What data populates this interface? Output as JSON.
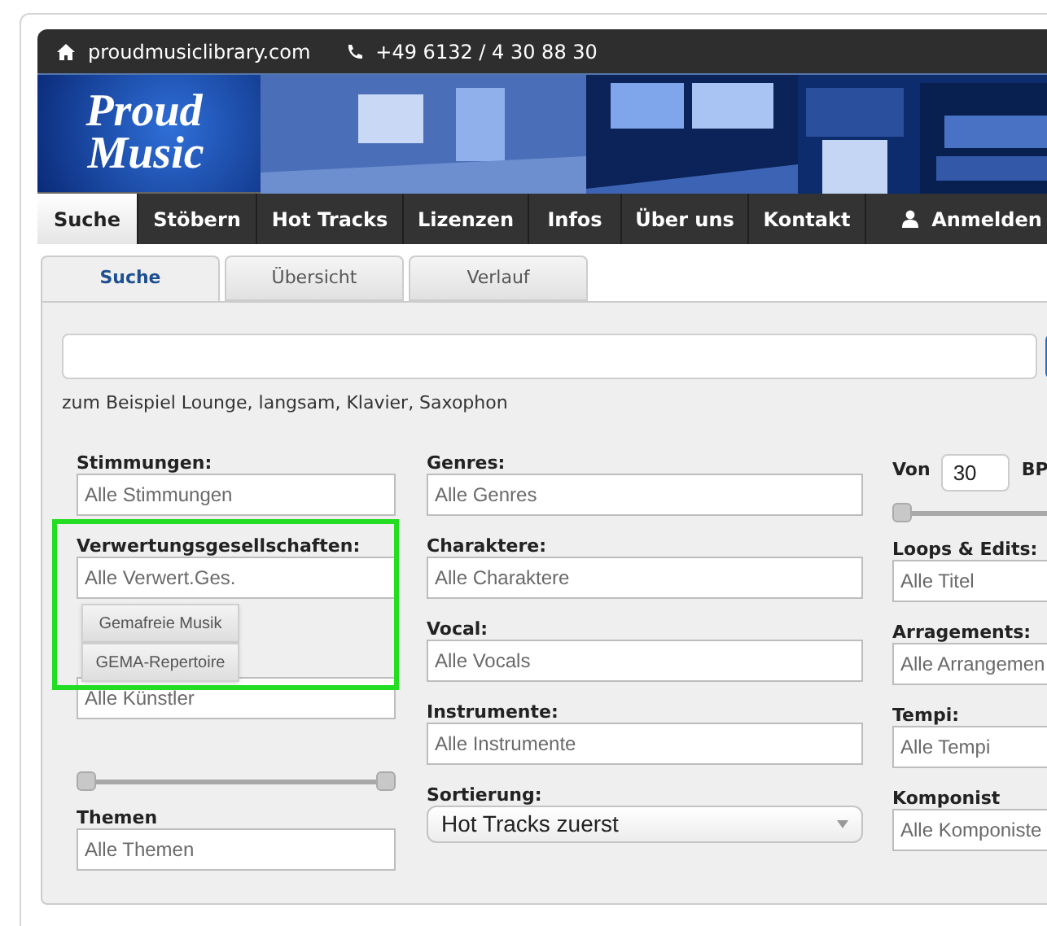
{
  "top_bar": {
    "website": "proudmusiclibrary.com",
    "phone": "+49 6132 / 4 30 88 30"
  },
  "logo": {
    "line_1": "Proud",
    "line_2": "Music"
  },
  "nav": [
    {
      "label": "Suche",
      "selected": true
    },
    {
      "label": "Stöbern",
      "selected": false
    },
    {
      "label": "Hot Tracks",
      "selected": false
    },
    {
      "label": "Lizenzen",
      "selected": false
    },
    {
      "label": "Infos",
      "selected": false
    },
    {
      "label": "Über uns",
      "selected": false
    },
    {
      "label": "Kontakt",
      "selected": false
    },
    {
      "label": "Anmelden",
      "selected": false,
      "kind": "login"
    }
  ],
  "tabs": [
    {
      "label": "Suche",
      "selected": true
    },
    {
      "label": "Übersicht",
      "selected": false
    },
    {
      "label": "Verlauf",
      "selected": false
    }
  ],
  "search": {
    "hint": "zum Beispiel Lounge, langsam, Klavier, Saxophon"
  },
  "columns": [
    [
      {
        "kind": "field",
        "label": "Stimmungen:",
        "placeholder": "Alle Stimmungen"
      },
      {
        "kind": "field",
        "label": "Verwertungsgesellschaften:",
        "placeholder": "Alle Verwert.Ges.",
        "expanded": true,
        "highlighted": true,
        "options": [
          "Gemafreie Musik",
          "GEMA-Repertoire"
        ]
      },
      {
        "kind": "field",
        "placeholder": "Alle Künstler"
      },
      {
        "kind": "range",
        "thumbs": [
          {
            "level": 0
          },
          {
            "level": 1
          }
        ]
      },
      {
        "kind": "field",
        "label": "Themen",
        "placeholder": "Alle Themen"
      }
    ],
    [
      {
        "kind": "field",
        "label": "Genres:",
        "placeholder": "Alle Genres"
      },
      {
        "kind": "field",
        "label": "Charaktere:",
        "placeholder": "Alle Charaktere"
      },
      {
        "kind": "field",
        "label": "Vocal:",
        "placeholder": "Alle Vocals"
      },
      {
        "kind": "field",
        "label": "Instrumente:",
        "placeholder": "Alle Instrumente"
      },
      {
        "kind": "dropdown",
        "label": "Sortierung:",
        "value": "Hot Tracks zuerst"
      }
    ],
    [
      {
        "kind": "bpm",
        "label": "Von",
        "value": "30",
        "unit": "BP"
      },
      {
        "kind": "slider",
        "level": 0
      },
      {
        "kind": "field",
        "label": "Loops & Edits:",
        "placeholder": "Alle Titel"
      },
      {
        "kind": "field",
        "label": "Arragements:",
        "placeholder": "Alle Arrangemen"
      },
      {
        "kind": "field",
        "label": "Tempi:",
        "placeholder": "Alle Tempi"
      },
      {
        "kind": "field",
        "label": "Komponist",
        "placeholder": "Alle Komponiste"
      }
    ]
  ]
}
